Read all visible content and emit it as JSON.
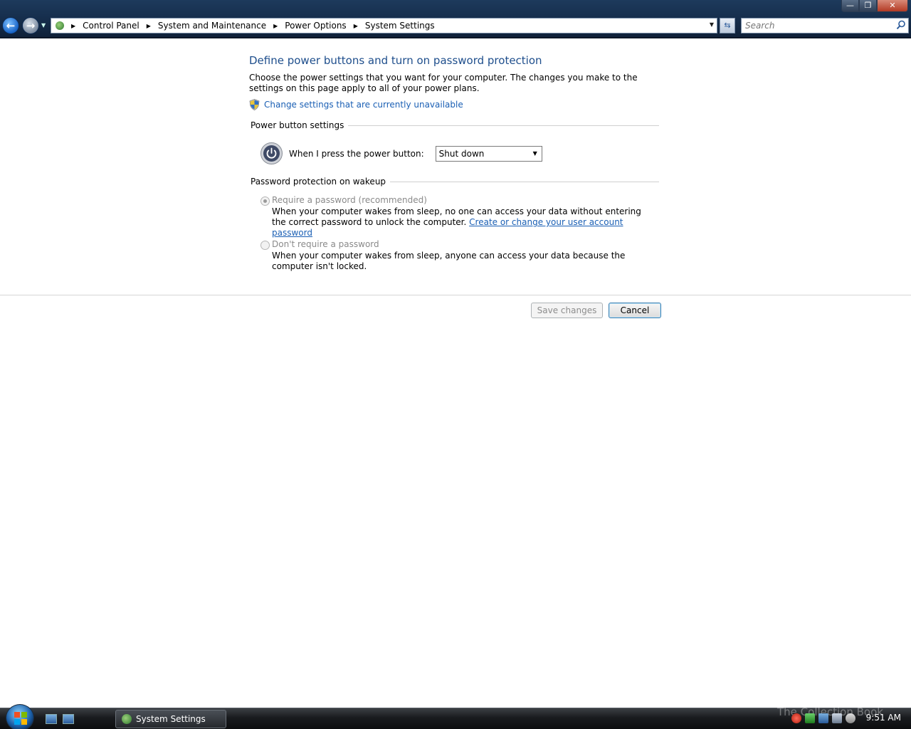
{
  "window": {
    "minimize_glyph": "—",
    "maximize_glyph": "❐",
    "close_glyph": "✕"
  },
  "address_bar": {
    "breadcrumbs": [
      "Control Panel",
      "System and Maintenance",
      "Power Options",
      "System Settings"
    ],
    "search_placeholder": "Search"
  },
  "page": {
    "title": "Define power buttons and turn on password protection",
    "intro": "Choose the power settings that you want for your computer. The changes you make to the settings on this page apply to all of your power plans.",
    "uac_link": "Change settings that are currently unavailable"
  },
  "power_section": {
    "heading": "Power button settings",
    "label": "When I press the power button:",
    "selected": "Shut down"
  },
  "password_section": {
    "heading": "Password protection on wakeup",
    "require": {
      "label": "Require a password (recommended)",
      "description": "When your computer wakes from sleep, no one can access your data without entering the correct password to unlock the computer.",
      "link": "Create or change your user account password",
      "checked": true,
      "enabled": false
    },
    "none": {
      "label": "Don't require a password",
      "description": "When your computer wakes from sleep, anyone can access your data because the computer isn't locked.",
      "checked": false,
      "enabled": false
    }
  },
  "buttons": {
    "save": "Save changes",
    "cancel": "Cancel"
  },
  "taskbar": {
    "task_label": "System Settings",
    "watermark": "The Collection Book",
    "clock": "9:51 AM"
  },
  "colors": {
    "link": "#1a5fb4",
    "title": "#1e4e8c",
    "disabled_text": "#8a8a8a"
  }
}
